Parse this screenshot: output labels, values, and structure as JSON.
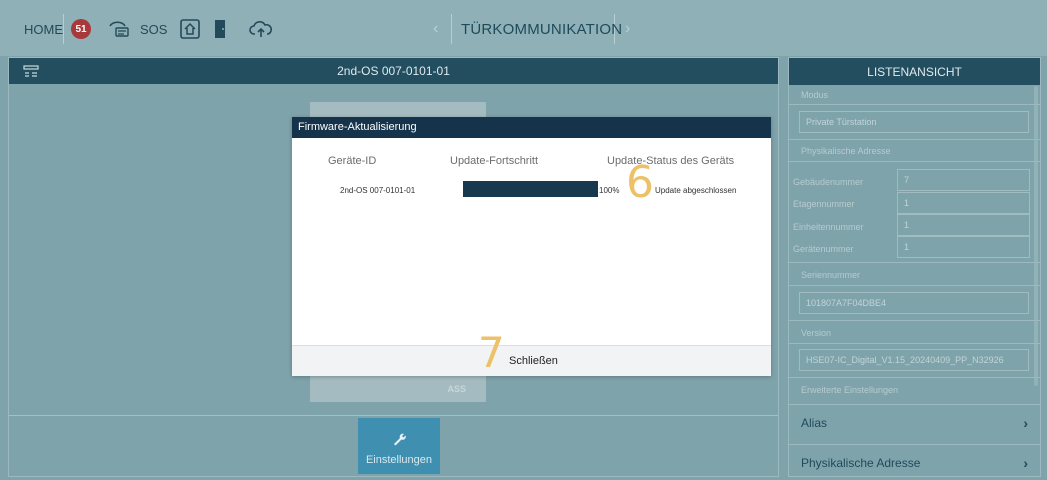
{
  "topbar": {
    "home_label": "HOME",
    "notification_count": "51",
    "sos_label": "SOS",
    "title": "TÜRKOMMUNIKATION",
    "prev_arrow": "‹",
    "next_arrow": "›"
  },
  "main": {
    "header_title": "2nd-OS 007-0101-01",
    "bg_tile_label": "ASS",
    "settings_button_label": "Einstellungen"
  },
  "dialog": {
    "title": "Firmware-Aktualisierung",
    "columns": [
      "Geräte-ID",
      "Update-Fortschritt",
      "Update-Status des Geräts"
    ],
    "rows": [
      {
        "device_id": "2nd-OS 007-0101-01",
        "progress": 1.0,
        "progress_label": "100%",
        "status": "Update abgeschlossen"
      }
    ],
    "close_label": "Schließen",
    "annotation_status": "6",
    "annotation_close": "7"
  },
  "right_panel": {
    "header_title": "LISTENANSICHT",
    "mode_label": "Modus",
    "mode_value": "Private Türstation",
    "phys_addr_label": "Physikalische Adresse",
    "building_label": "Gebäudenummer",
    "building_value": "7",
    "floor_label": "Etagennummer",
    "floor_value": "1",
    "unit_label": "Einheitennummer",
    "unit_value": "1",
    "device_label": "Gerätenummer",
    "device_value": "1",
    "serial_label": "Seriennummer",
    "serial_value": "101807A7F04DBE4",
    "version_label": "Version",
    "version_value": "HSE07-IC_Digital_V1.15_20240409_PP_N32926",
    "advanced_label": "Erweiterte Einstellungen",
    "alias_label": "Alias",
    "phys_addr_link_label": "Physikalische Adresse"
  },
  "colors": {
    "header_dark": "#234e60",
    "dialog_title": "#15334a",
    "progress_fill": "#17384f",
    "badge": "#a8383a",
    "settings_button": "#3f8fb0",
    "annotation": "#ecc167"
  }
}
